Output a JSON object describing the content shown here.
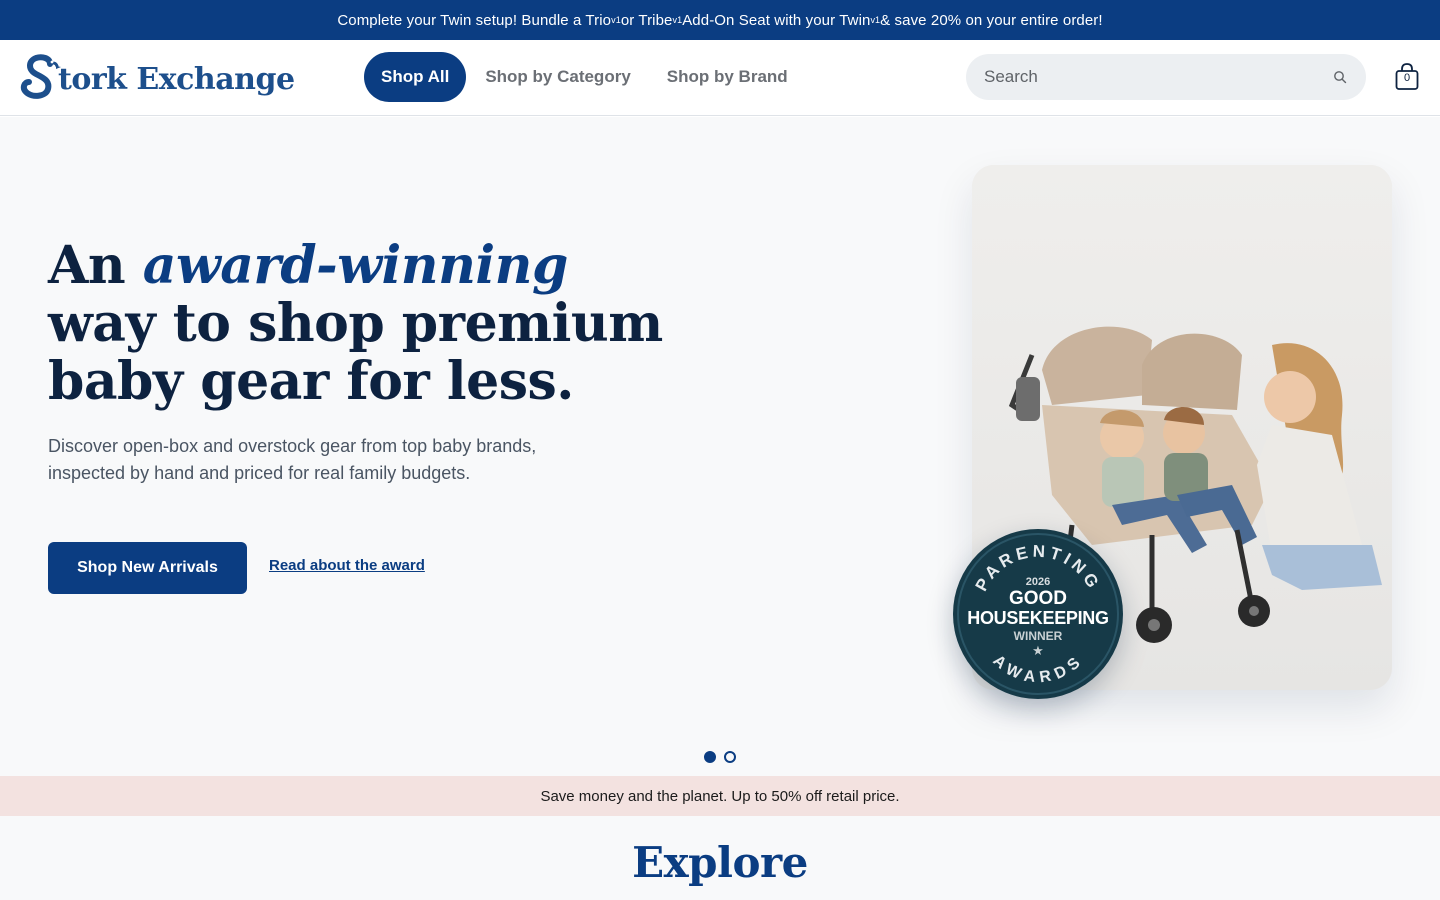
{
  "announcement": {
    "part1": "Complete your Twin setup! Bundle a Trio",
    "sup1": "v1",
    "part2": " or Tribe",
    "sup2": "v1",
    "part3": " Add-On Seat with your Twin",
    "sup3": "v1",
    "part4": " & save 20% on your entire order!"
  },
  "header": {
    "logo_text": "tork Exchange",
    "nav": [
      {
        "label": "Shop All",
        "active": true
      },
      {
        "label": "Shop by Category",
        "active": false
      },
      {
        "label": "Shop by Brand",
        "active": false
      }
    ],
    "search_placeholder": "Search",
    "cart_count": "0"
  },
  "hero": {
    "title_before": "An ",
    "title_emphasis": "award-winning",
    "title_after": " way to shop premium baby gear for less.",
    "subtitle": "Discover open-box and overstock gear from top baby brands, inspected by hand and priced for real family budgets.",
    "primary_cta": "Shop New Arrivals",
    "secondary_cta": "Read about the award",
    "badge": {
      "top_arc": "PARENTING",
      "year": "2026",
      "line1": "GOOD",
      "line2": "HOUSEKEEPING",
      "line3": "WINNER",
      "bottom_arc": "AWARDS"
    },
    "carousel": {
      "total_slides": 2,
      "active_slide": 1
    }
  },
  "promo_bar": "Save money and the planet. Up to 50% off retail price.",
  "explore_title": "Explore",
  "colors": {
    "brand_blue": "#0b3d82",
    "navy_text": "#0d2240",
    "promo_pink": "#f3e2e0",
    "hero_bg": "#f8f9fa",
    "badge_teal": "#163a48"
  }
}
